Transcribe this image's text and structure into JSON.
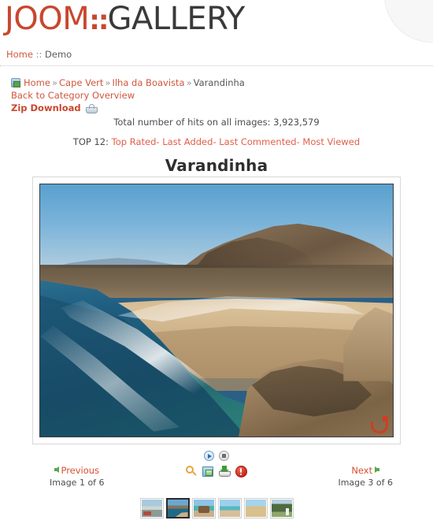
{
  "site": {
    "logo_primary": "JOOM",
    "logo_separator": "::",
    "logo_secondary": "GALLERY"
  },
  "topmenu": {
    "home_label": "Home",
    "separator": "::",
    "current_label": "Demo"
  },
  "breadcrumb": {
    "icon": "home-folder-icon",
    "items": [
      {
        "label": "Home",
        "link": true
      },
      {
        "label": "Cape Vert",
        "link": true
      },
      {
        "label": "Ilha da Boavista",
        "link": true
      },
      {
        "label": "Varandinha",
        "link": false
      }
    ],
    "arrow": "»",
    "back_link": "Back to Category Overview",
    "zip_label": "Zip Download",
    "zip_icon": "zip-basket-icon"
  },
  "stats": {
    "hits_text": "Total number of hits on all images: 3,923,579",
    "top12_prefix": "TOP 12:",
    "top12_links": [
      "Top Rated",
      "Last Added",
      "Last Commented",
      "Most Viewed"
    ],
    "top12_dash": "-"
  },
  "image": {
    "title": "Varandinha",
    "watermark": "jg-watermark"
  },
  "controls": {
    "play_label": "play-slideshow",
    "stop_label": "stop-slideshow",
    "icons": [
      "zoom-fullsize-icon",
      "ecard-icon",
      "download-icon",
      "report-image-icon"
    ]
  },
  "navigation": {
    "previous_label": "Previous",
    "previous_count": "Image 1 of 6",
    "next_label": "Next",
    "next_count": "Image 3 of 6"
  },
  "thumbnails": {
    "count": 6,
    "selected_index": 1,
    "items": [
      {
        "name": "thumb-1"
      },
      {
        "name": "thumb-2"
      },
      {
        "name": "thumb-3"
      },
      {
        "name": "thumb-4"
      },
      {
        "name": "thumb-5"
      },
      {
        "name": "thumb-6"
      }
    ]
  },
  "colors": {
    "brand_red": "#c8472e",
    "link_red": "#d0573c",
    "logo_dark": "#3a3a3a",
    "arrow_green": "#5aa74b",
    "text_gray": "#4d4d4d"
  }
}
